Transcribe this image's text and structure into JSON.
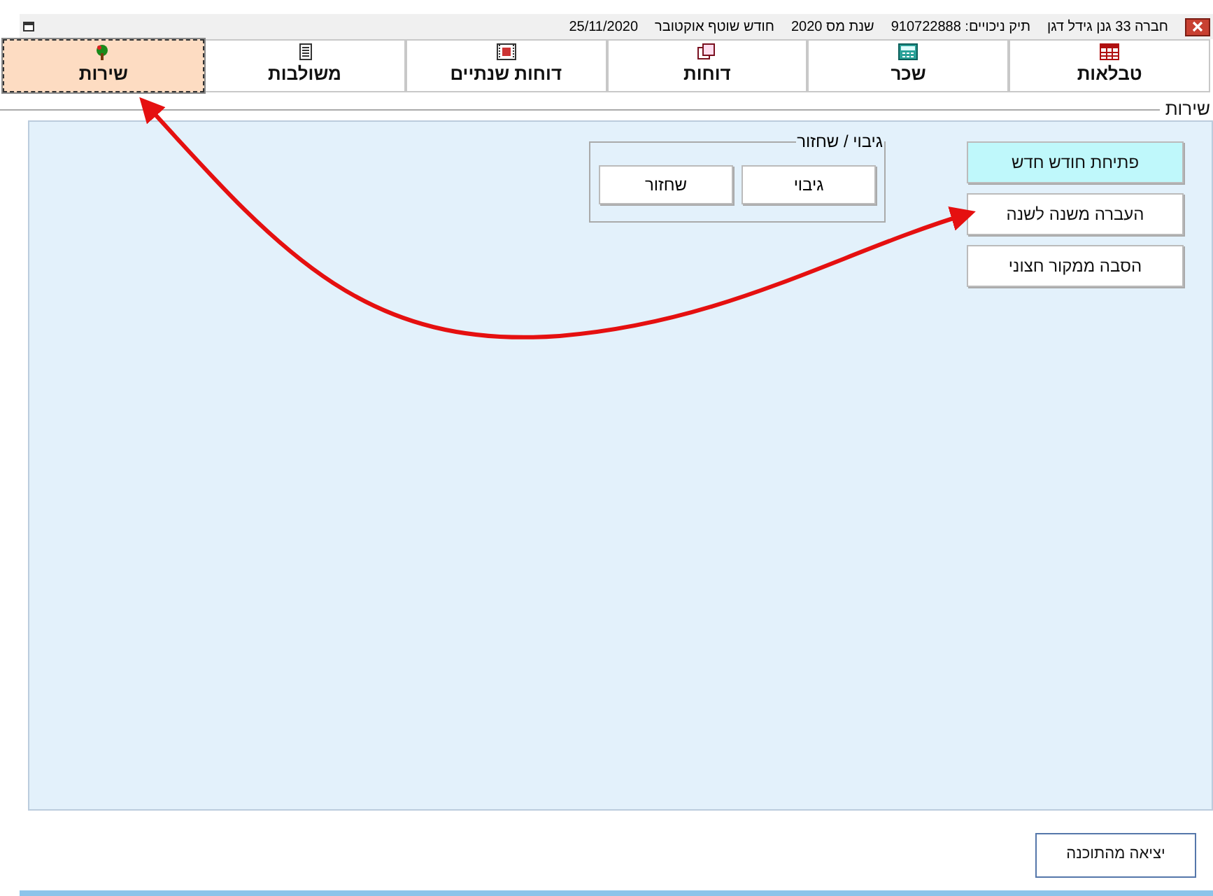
{
  "window": {
    "title_parts": [
      "חברה 33 גנן גידל דגן",
      "תיק ניכויים: 910722888",
      "שנת מס 2020",
      "חודש שוטף אוקטובר",
      "25/11/2020"
    ]
  },
  "tabs": [
    {
      "label": "טבלאות",
      "selected": false
    },
    {
      "label": "שכר",
      "selected": false
    },
    {
      "label": "דוחות",
      "selected": false
    },
    {
      "label": "דוחות שנתיים",
      "selected": false
    },
    {
      "label": "משולבות",
      "selected": false
    },
    {
      "label": "שירות",
      "selected": true
    }
  ],
  "section_title": "שירות",
  "actions": [
    {
      "label": "פתיחת חודש חדש",
      "highlighted": true
    },
    {
      "label": "העברה משנה לשנה",
      "highlighted": false
    },
    {
      "label": "הסבה ממקור חצוני",
      "highlighted": false
    }
  ],
  "backup_group": {
    "title": "גיבוי / שחזור",
    "buttons": [
      "גיבוי",
      "שחזור"
    ]
  },
  "exit_button": "יציאה מהתוכנה"
}
